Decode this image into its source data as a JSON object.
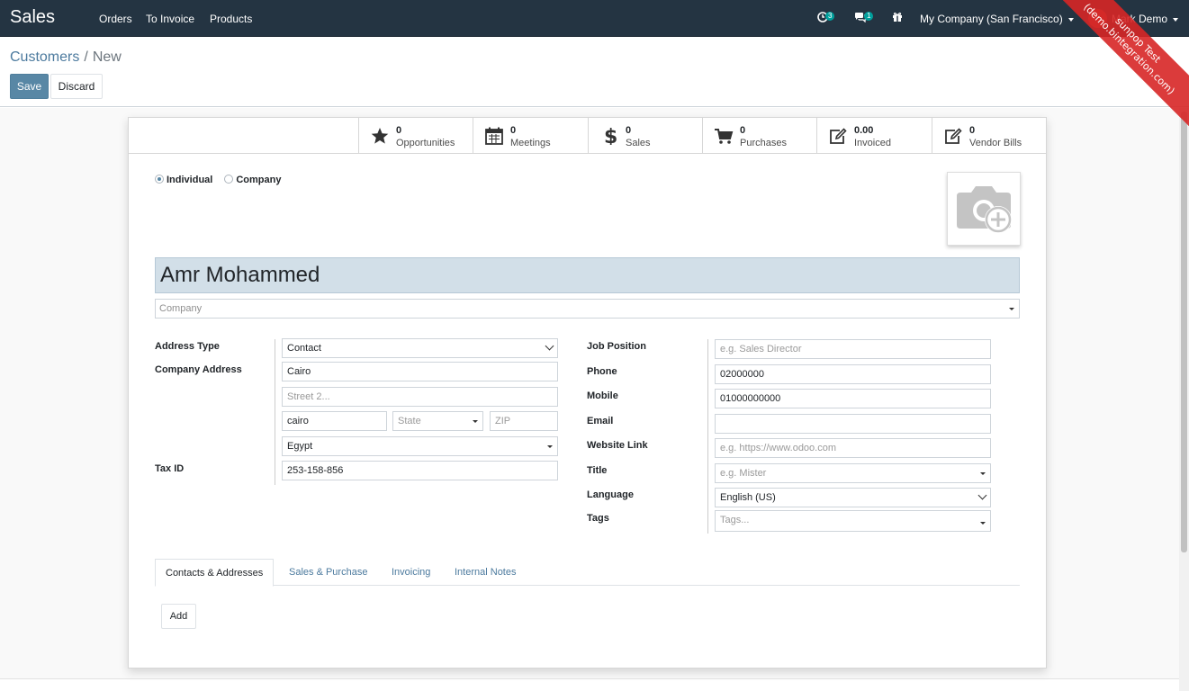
{
  "navbar": {
    "brand": "Sales",
    "menu": [
      {
        "label": "Orders"
      },
      {
        "label": "To Invoice"
      },
      {
        "label": "Products"
      }
    ],
    "activity_count": "3",
    "message_count": "1",
    "company_switcher": "My Company (San Francisco)",
    "user_name": "Mark Demo"
  },
  "ribbon": {
    "line1": "sunpop Test",
    "line2": "(demo.bintegration.com)"
  },
  "control_panel": {
    "breadcrumb_parent": "Customers",
    "breadcrumb_separator": "/",
    "breadcrumb_current": "New",
    "save_label": "Save",
    "discard_label": "Discard"
  },
  "stat_buttons": [
    {
      "value": "0",
      "label": "Opportunities",
      "icon": "star-icon"
    },
    {
      "value": "0",
      "label": "Meetings",
      "icon": "calendar-icon"
    },
    {
      "value": "0",
      "label": "Sales",
      "icon": "dollar-icon"
    },
    {
      "value": "0",
      "label": "Purchases",
      "icon": "shopping-cart-icon"
    },
    {
      "value": "0.00",
      "label": "Invoiced",
      "icon": "edit-icon"
    },
    {
      "value": "0",
      "label": "Vendor Bills",
      "icon": "edit-icon"
    }
  ],
  "company_type": {
    "options": [
      {
        "label": "Individual",
        "checked": true
      },
      {
        "label": "Company",
        "checked": false
      }
    ]
  },
  "form": {
    "name": "Amr Mohammed",
    "company_placeholder": "Company",
    "address_type_label": "Address Type",
    "address_type_value": "Contact",
    "company_address_label": "Company Address",
    "street": "Cairo",
    "street2_placeholder": "Street 2...",
    "city": "cairo",
    "state_placeholder": "State",
    "zip_placeholder": "ZIP",
    "country": "Egypt",
    "tax_id_label": "Tax ID",
    "tax_id": "253-158-856",
    "job_position_label": "Job Position",
    "job_position_placeholder": "e.g. Sales Director",
    "phone_label": "Phone",
    "phone": "02000000",
    "mobile_label": "Mobile",
    "mobile": "01000000000",
    "email_label": "Email",
    "email": "",
    "website_label": "Website Link",
    "website_placeholder": "e.g. https://www.odoo.com",
    "title_label": "Title",
    "title_placeholder": "e.g. Mister",
    "language_label": "Language",
    "language": "English (US)",
    "tags_label": "Tags",
    "tags_placeholder": "Tags..."
  },
  "tabs": [
    {
      "label": "Contacts & Addresses",
      "active": true
    },
    {
      "label": "Sales & Purchase",
      "active": false
    },
    {
      "label": "Invoicing",
      "active": false
    },
    {
      "label": "Internal Notes",
      "active": false
    }
  ],
  "add_label": "Add",
  "colors": {
    "navbar": "#243442",
    "primary": "#5887a5",
    "link": "#4c7a9e",
    "name_highlight": "#d2dfe8",
    "badge": "#00a09d",
    "ribbon": "#d72626"
  }
}
